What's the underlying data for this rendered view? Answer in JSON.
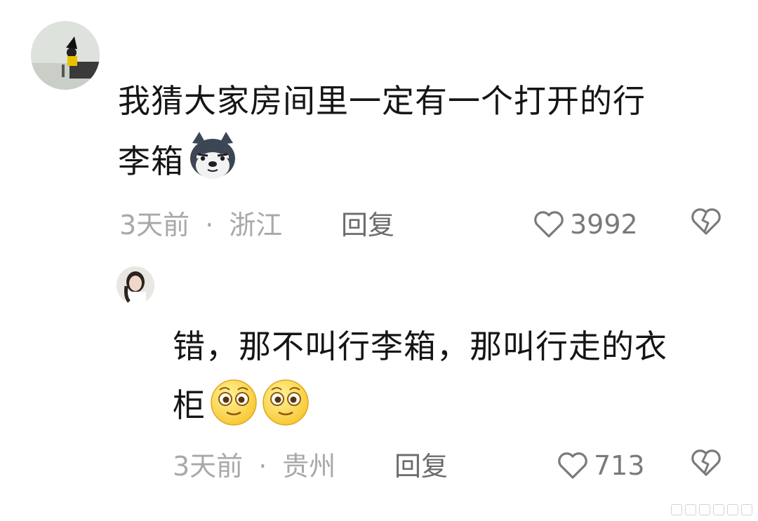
{
  "comments": [
    {
      "text_line1": "我猜大家房间里一定有一个打开的行",
      "text_line2": "李箱",
      "emoji": "husky-dog-emoji",
      "time": "3天前",
      "separator": "·",
      "region": "浙江",
      "reply_label": "回复",
      "like_count": "3992"
    },
    {
      "text_line1": "错，那不叫行李箱，那叫行走的衣",
      "text_line2": "柜",
      "emoji": "smiley-face-emoji",
      "time": "3天前",
      "separator": "·",
      "region": "贵州",
      "reply_label": "回复",
      "like_count": "713"
    }
  ],
  "icons": {
    "like": "heart-outline-icon",
    "dislike": "broken-heart-icon"
  },
  "colors": {
    "text": "#151515",
    "meta": "#a8a8a8",
    "reply": "#6c6c6c",
    "background": "#ffffff"
  }
}
